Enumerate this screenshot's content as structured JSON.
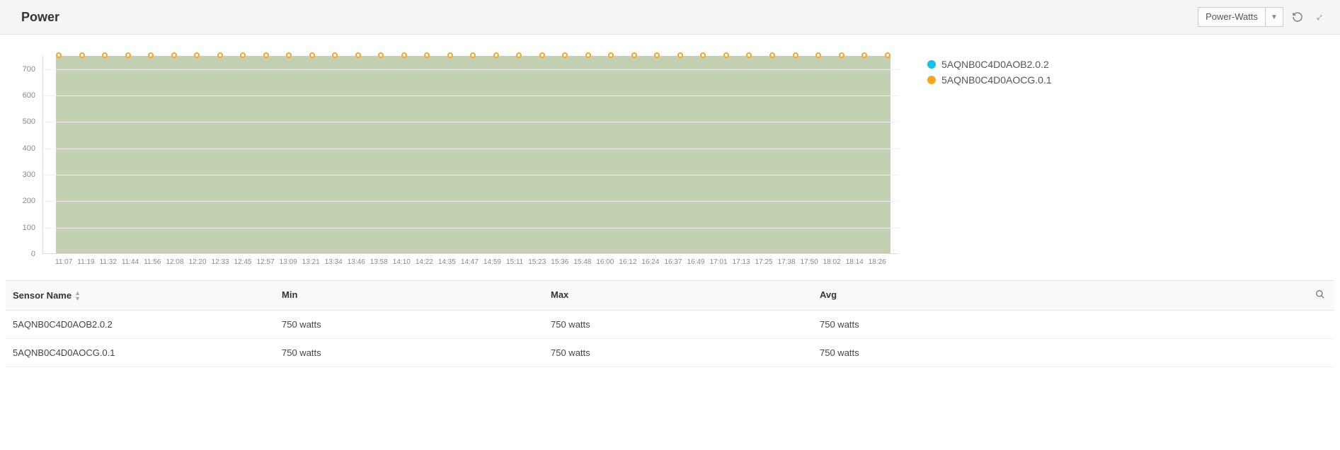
{
  "header": {
    "title": "Power",
    "select_label": "Power-Watts"
  },
  "legend": {
    "items": [
      {
        "label": "5AQNB0C4D0AOB2.0.2",
        "colorClass": "dot-cyan"
      },
      {
        "label": "5AQNB0C4D0AOCG.0.1",
        "colorClass": "dot-orange"
      }
    ]
  },
  "chart_data": {
    "type": "area",
    "title": "Power",
    "xlabel": "",
    "ylabel": "",
    "ylim": [
      0,
      750
    ],
    "y_ticks": [
      0,
      100,
      200,
      300,
      400,
      500,
      600,
      700
    ],
    "x": [
      "11:07",
      "11:19",
      "11:32",
      "11:44",
      "11:56",
      "12:08",
      "12:20",
      "12:33",
      "12:45",
      "12:57",
      "13:09",
      "13:21",
      "13:34",
      "13:46",
      "13:58",
      "14:10",
      "14:22",
      "14:35",
      "14:47",
      "14:59",
      "15:11",
      "15:23",
      "15:36",
      "15:48",
      "16:00",
      "16:12",
      "16:24",
      "16:37",
      "16:49",
      "17:01",
      "17:13",
      "17:25",
      "17:38",
      "17:50",
      "18:02",
      "18:14",
      "18:26"
    ],
    "series": [
      {
        "name": "5AQNB0C4D0AOB2.0.2",
        "color": "#15c1e6",
        "values": [
          750,
          750,
          750,
          750,
          750,
          750,
          750,
          750,
          750,
          750,
          750,
          750,
          750,
          750,
          750,
          750,
          750,
          750,
          750,
          750,
          750,
          750,
          750,
          750,
          750,
          750,
          750,
          750,
          750,
          750,
          750,
          750,
          750,
          750,
          750,
          750,
          750
        ]
      },
      {
        "name": "5AQNB0C4D0AOCG.0.1",
        "color": "#f5a623",
        "values": [
          750,
          750,
          750,
          750,
          750,
          750,
          750,
          750,
          750,
          750,
          750,
          750,
          750,
          750,
          750,
          750,
          750,
          750,
          750,
          750,
          750,
          750,
          750,
          750,
          750,
          750,
          750,
          750,
          750,
          750,
          750,
          750,
          750,
          750,
          750,
          750,
          750
        ]
      }
    ]
  },
  "table": {
    "headers": {
      "name": "Sensor Name",
      "min": "Min",
      "max": "Max",
      "avg": "Avg"
    },
    "rows": [
      {
        "name": "5AQNB0C4D0AOB2.0.2",
        "min": "750 watts",
        "max": "750 watts",
        "avg": "750 watts"
      },
      {
        "name": "5AQNB0C4D0AOCG.0.1",
        "min": "750 watts",
        "max": "750 watts",
        "avg": "750 watts"
      }
    ]
  }
}
